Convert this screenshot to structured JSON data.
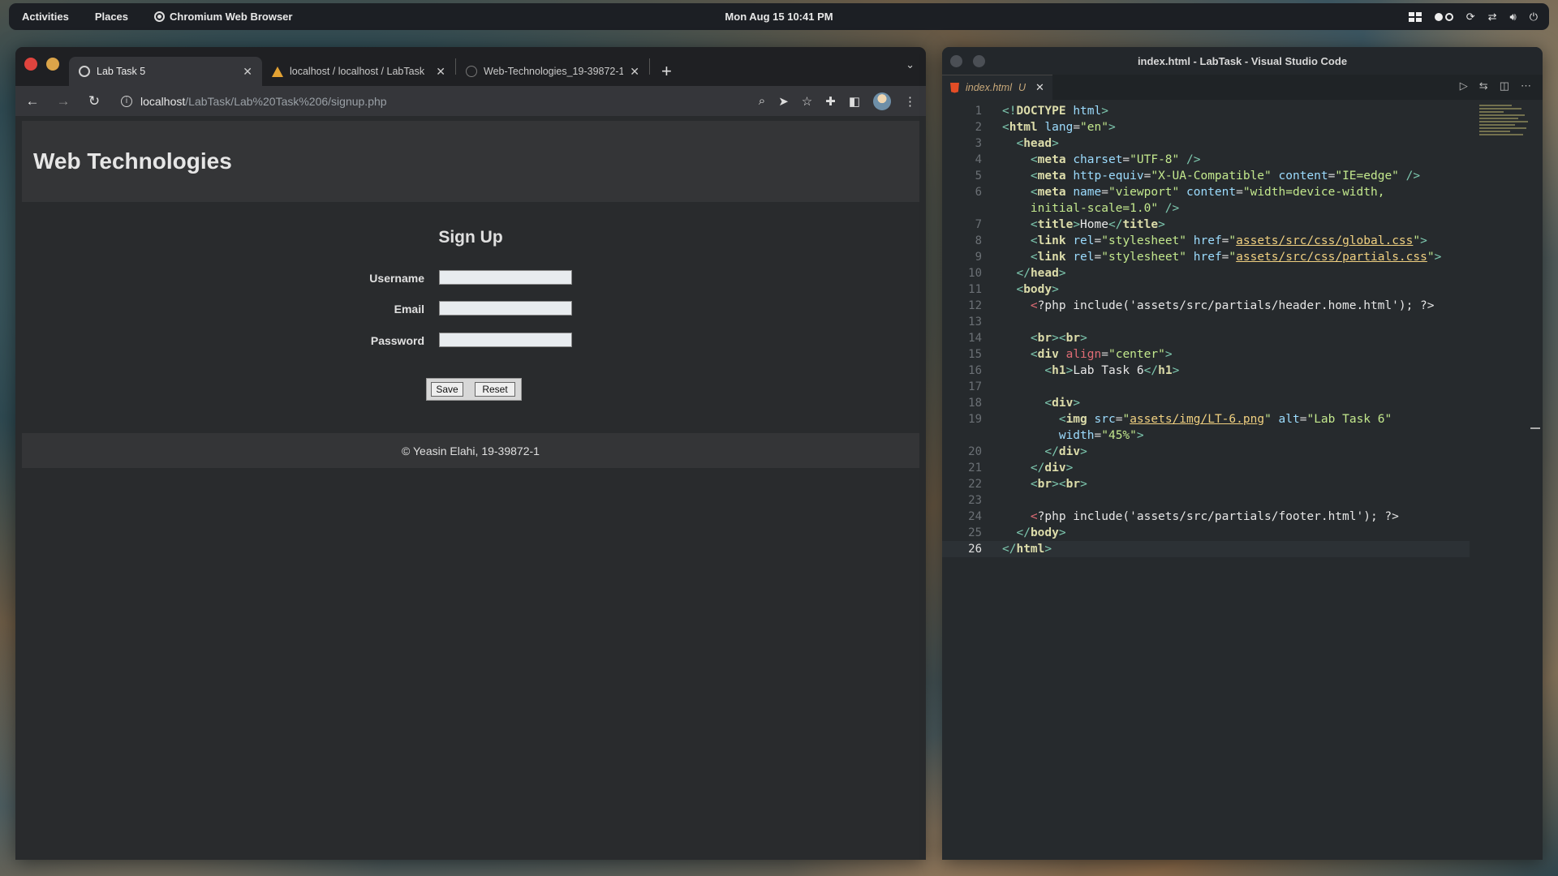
{
  "topbar": {
    "activities": "Activities",
    "places": "Places",
    "app_name": "Chromium Web Browser",
    "clock": "Mon Aug 15  10:41 PM"
  },
  "browser": {
    "tabs": [
      {
        "title": "Lab Task 5",
        "favicon": "globe-icon",
        "active": true
      },
      {
        "title": "localhost / localhost / LabTask",
        "favicon": "phpmyadmin-icon",
        "active": false
      },
      {
        "title": "Web-Technologies_19-39872-1/",
        "favicon": "github-icon",
        "active": false
      }
    ],
    "url_host": "localhost",
    "url_path": "/LabTask/Lab%20Task%206/signup.php",
    "page": {
      "site_title": "Web Technologies",
      "form_title": "Sign Up",
      "fields": [
        {
          "label": "Username",
          "value": ""
        },
        {
          "label": "Email",
          "value": ""
        },
        {
          "label": "Password",
          "value": ""
        }
      ],
      "save_label": "Save",
      "reset_label": "Reset",
      "footer": "© Yeasin Elahi, 19-39872-1"
    }
  },
  "vscode": {
    "window_title": "index.html - LabTask - Visual Studio Code",
    "tab_title": "index.html",
    "tab_status": "U",
    "current_line": 26
  },
  "colors": {
    "close": "#e0443e",
    "minimize": "#dba449",
    "accent": "#e44d26"
  }
}
